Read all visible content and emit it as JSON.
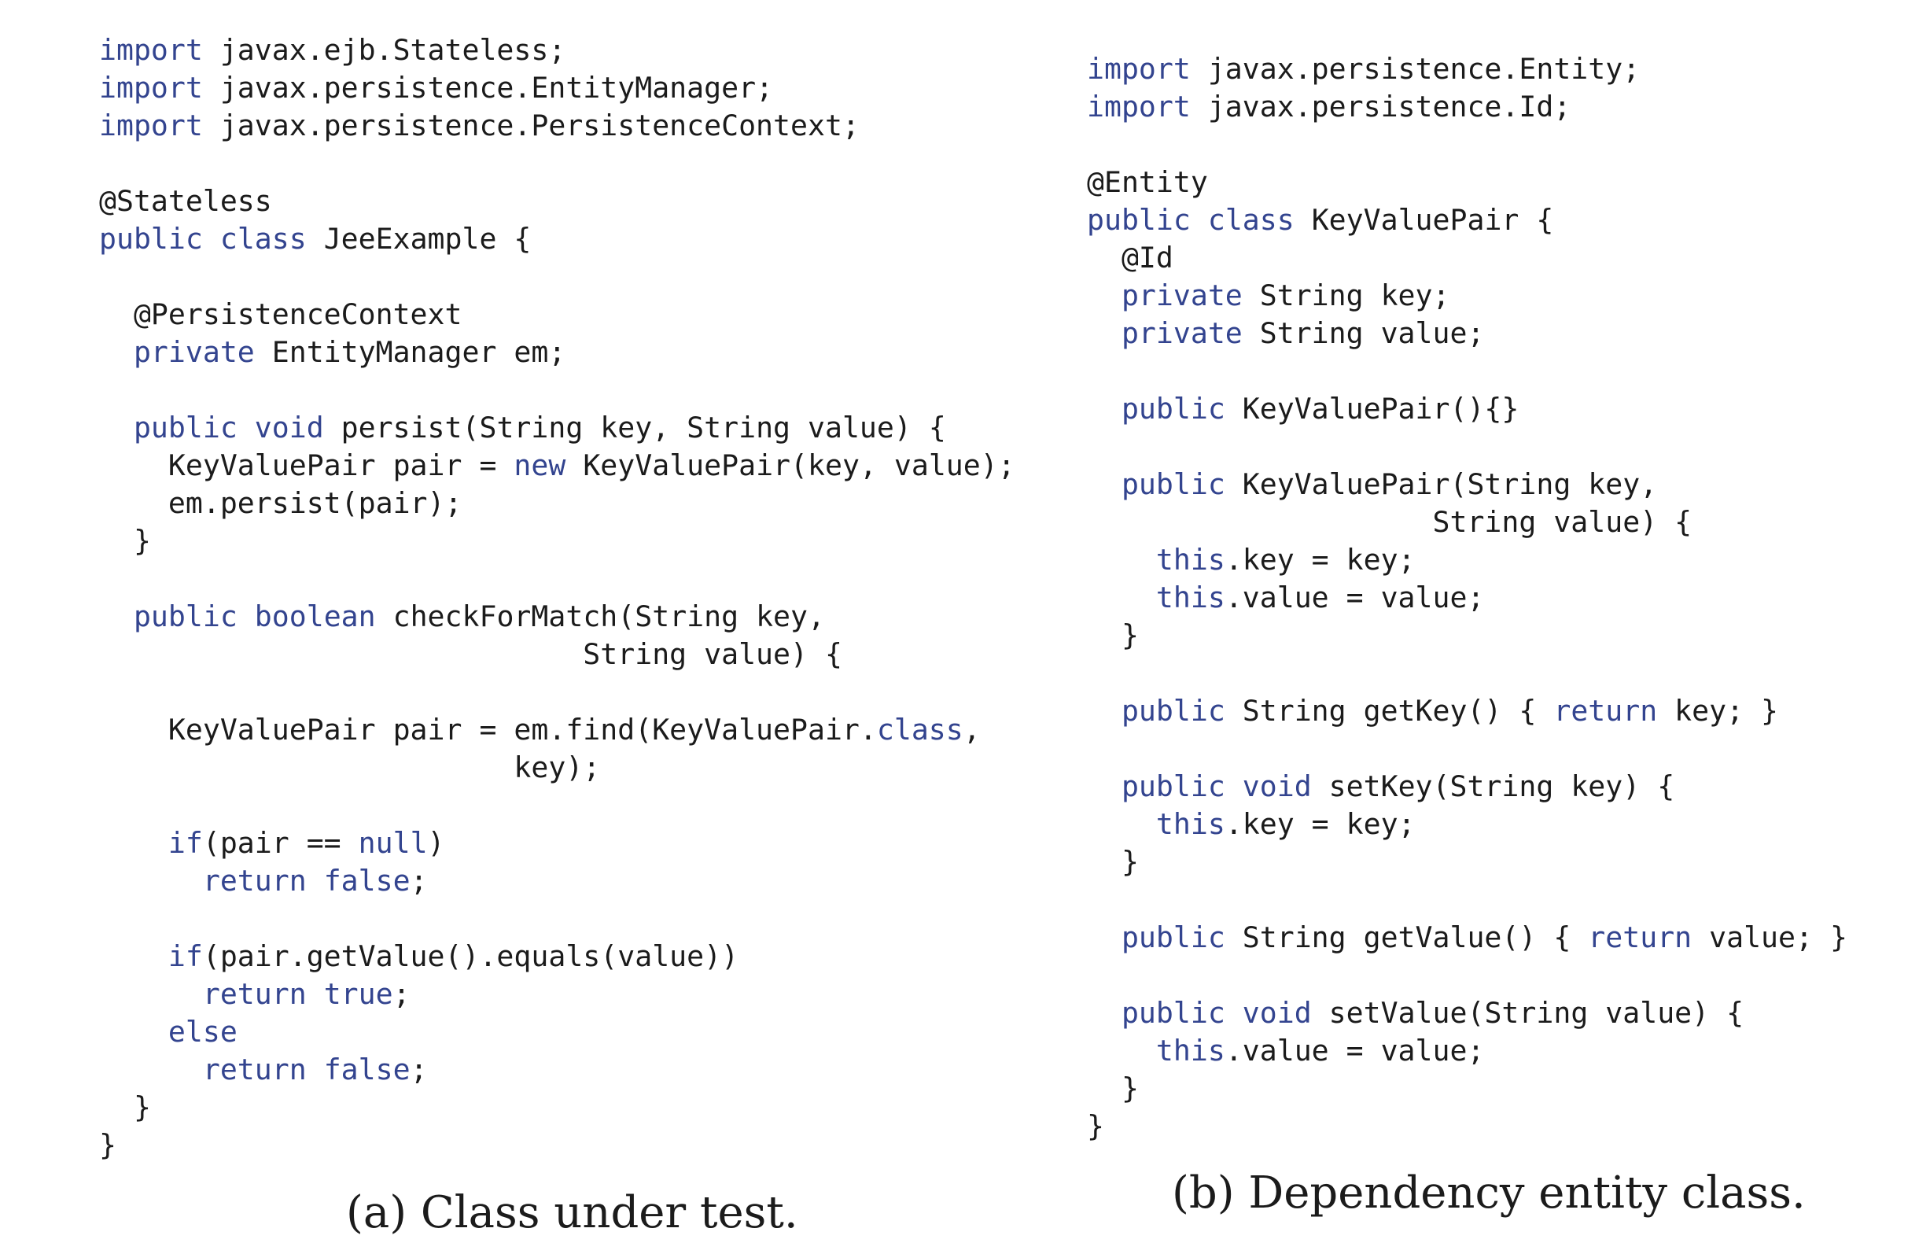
{
  "listings": {
    "a": {
      "caption": "(a) Class under test.",
      "lines": [
        [
          {
            "t": "import",
            "k": true
          },
          {
            "t": " javax.ejb.Stateless;"
          }
        ],
        [
          {
            "t": "import",
            "k": true
          },
          {
            "t": " javax.persistence.EntityManager;"
          }
        ],
        [
          {
            "t": "import",
            "k": true
          },
          {
            "t": " javax.persistence.PersistenceContext;"
          }
        ],
        [],
        [
          {
            "t": "@Stateless"
          }
        ],
        [
          {
            "t": "public",
            "k": true
          },
          {
            "t": " "
          },
          {
            "t": "class",
            "k": true
          },
          {
            "t": " JeeExample {"
          }
        ],
        [],
        [
          {
            "t": "  @PersistenceContext"
          }
        ],
        [
          {
            "t": "  "
          },
          {
            "t": "private",
            "k": true
          },
          {
            "t": " EntityManager em;"
          }
        ],
        [],
        [
          {
            "t": "  "
          },
          {
            "t": "public",
            "k": true
          },
          {
            "t": " "
          },
          {
            "t": "void",
            "k": true
          },
          {
            "t": " persist(String key, String value) {"
          }
        ],
        [
          {
            "t": "    KeyValuePair pair = "
          },
          {
            "t": "new",
            "k": true
          },
          {
            "t": " KeyValuePair(key, value);"
          }
        ],
        [
          {
            "t": "    em.persist(pair);"
          }
        ],
        [
          {
            "t": "  }"
          }
        ],
        [],
        [
          {
            "t": "  "
          },
          {
            "t": "public",
            "k": true
          },
          {
            "t": " "
          },
          {
            "t": "boolean",
            "k": true
          },
          {
            "t": " checkForMatch(String key,"
          }
        ],
        [
          {
            "t": "                            String value) {"
          }
        ],
        [],
        [
          {
            "t": "    KeyValuePair pair = em.find(KeyValuePair."
          },
          {
            "t": "class",
            "k": true
          },
          {
            "t": ","
          }
        ],
        [
          {
            "t": "                        key);"
          }
        ],
        [],
        [
          {
            "t": "    "
          },
          {
            "t": "if",
            "k": true
          },
          {
            "t": "(pair == "
          },
          {
            "t": "null",
            "k": true
          },
          {
            "t": ")"
          }
        ],
        [
          {
            "t": "      "
          },
          {
            "t": "return",
            "k": true
          },
          {
            "t": " "
          },
          {
            "t": "false",
            "k": true
          },
          {
            "t": ";"
          }
        ],
        [],
        [
          {
            "t": "    "
          },
          {
            "t": "if",
            "k": true
          },
          {
            "t": "(pair.getValue().equals(value))"
          }
        ],
        [
          {
            "t": "      "
          },
          {
            "t": "return",
            "k": true
          },
          {
            "t": " "
          },
          {
            "t": "true",
            "k": true
          },
          {
            "t": ";"
          }
        ],
        [
          {
            "t": "    "
          },
          {
            "t": "else",
            "k": true
          }
        ],
        [
          {
            "t": "      "
          },
          {
            "t": "return",
            "k": true
          },
          {
            "t": " "
          },
          {
            "t": "false",
            "k": true
          },
          {
            "t": ";"
          }
        ],
        [
          {
            "t": "  }"
          }
        ],
        [
          {
            "t": "}"
          }
        ]
      ]
    },
    "b": {
      "caption": "(b) Dependency entity class.",
      "lines": [
        [
          {
            "t": "import",
            "k": true
          },
          {
            "t": " javax.persistence.Entity;"
          }
        ],
        [
          {
            "t": "import",
            "k": true
          },
          {
            "t": " javax.persistence.Id;"
          }
        ],
        [],
        [
          {
            "t": "@Entity"
          }
        ],
        [
          {
            "t": "public",
            "k": true
          },
          {
            "t": " "
          },
          {
            "t": "class",
            "k": true
          },
          {
            "t": " KeyValuePair {"
          }
        ],
        [
          {
            "t": "  @Id"
          }
        ],
        [
          {
            "t": "  "
          },
          {
            "t": "private",
            "k": true
          },
          {
            "t": " String key;"
          }
        ],
        [
          {
            "t": "  "
          },
          {
            "t": "private",
            "k": true
          },
          {
            "t": " String value;"
          }
        ],
        [],
        [
          {
            "t": "  "
          },
          {
            "t": "public",
            "k": true
          },
          {
            "t": " KeyValuePair(){}"
          }
        ],
        [],
        [
          {
            "t": "  "
          },
          {
            "t": "public",
            "k": true
          },
          {
            "t": " KeyValuePair(String key,"
          }
        ],
        [
          {
            "t": "                    String value) {"
          }
        ],
        [
          {
            "t": "    "
          },
          {
            "t": "this",
            "k": true
          },
          {
            "t": ".key = key;"
          }
        ],
        [
          {
            "t": "    "
          },
          {
            "t": "this",
            "k": true
          },
          {
            "t": ".value = value;"
          }
        ],
        [
          {
            "t": "  }"
          }
        ],
        [],
        [
          {
            "t": "  "
          },
          {
            "t": "public",
            "k": true
          },
          {
            "t": " String getKey() { "
          },
          {
            "t": "return",
            "k": true
          },
          {
            "t": " key; }"
          }
        ],
        [],
        [
          {
            "t": "  "
          },
          {
            "t": "public",
            "k": true
          },
          {
            "t": " "
          },
          {
            "t": "void",
            "k": true
          },
          {
            "t": " setKey(String key) {"
          }
        ],
        [
          {
            "t": "    "
          },
          {
            "t": "this",
            "k": true
          },
          {
            "t": ".key = key;"
          }
        ],
        [
          {
            "t": "  }"
          }
        ],
        [],
        [
          {
            "t": "  "
          },
          {
            "t": "public",
            "k": true
          },
          {
            "t": " String getValue() { "
          },
          {
            "t": "return",
            "k": true
          },
          {
            "t": " value; }"
          }
        ],
        [],
        [
          {
            "t": "  "
          },
          {
            "t": "public",
            "k": true
          },
          {
            "t": " "
          },
          {
            "t": "void",
            "k": true
          },
          {
            "t": " setValue(String value) {"
          }
        ],
        [
          {
            "t": "    "
          },
          {
            "t": "this",
            "k": true
          },
          {
            "t": ".value = value;"
          }
        ],
        [
          {
            "t": "  }"
          }
        ],
        [
          {
            "t": "}"
          }
        ]
      ]
    }
  },
  "colors": {
    "text": "#1b1b1b",
    "keyword": "#33448f",
    "background": "#ffffff"
  }
}
